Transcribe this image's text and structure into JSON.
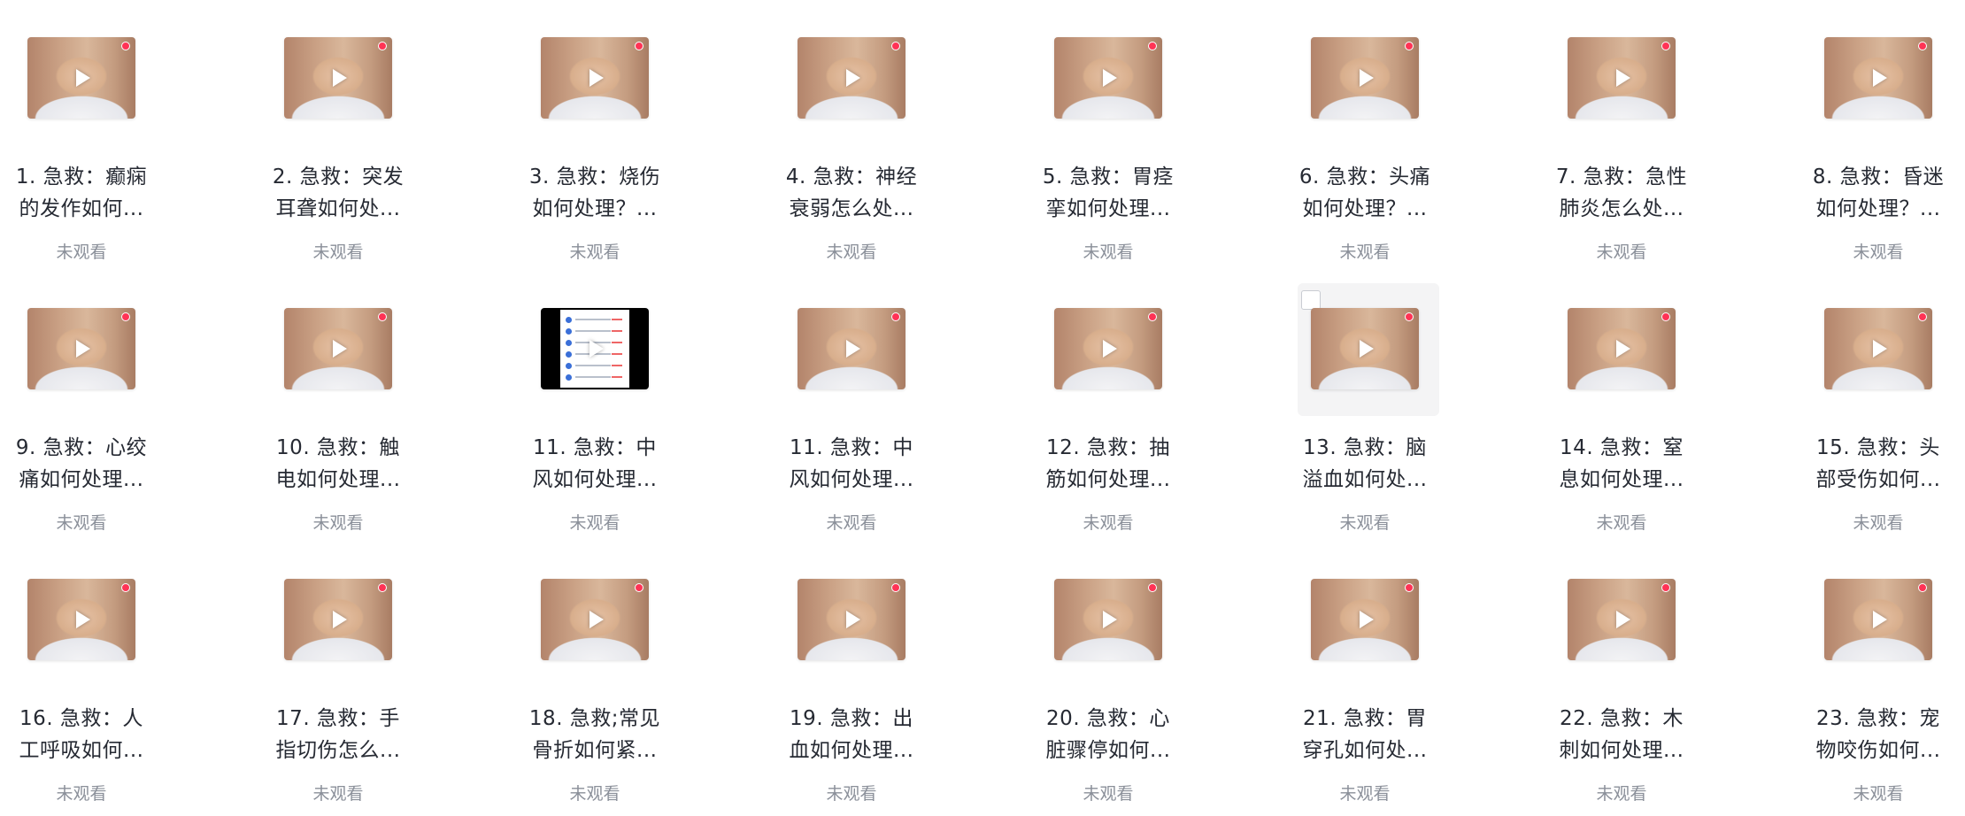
{
  "videos": [
    {
      "title1": "1. 急救：癫痫",
      "title2": "的发作如何...",
      "status": "未观看",
      "thumb": "photo"
    },
    {
      "title1": "2. 急救：突发",
      "title2": "耳聋如何处...",
      "status": "未观看",
      "thumb": "photo"
    },
    {
      "title1": "3. 急救：烧伤",
      "title2": "如何处理？...",
      "status": "未观看",
      "thumb": "photo"
    },
    {
      "title1": "4. 急救：神经",
      "title2": "衰弱怎么处...",
      "status": "未观看",
      "thumb": "photo"
    },
    {
      "title1": "5. 急救：胃痉",
      "title2": "挛如何处理...",
      "status": "未观看",
      "thumb": "photo"
    },
    {
      "title1": "6. 急救：头痛",
      "title2": "如何处理？...",
      "status": "未观看",
      "thumb": "photo"
    },
    {
      "title1": "7. 急救：急性",
      "title2": "肺炎怎么处...",
      "status": "未观看",
      "thumb": "photo"
    },
    {
      "title1": "8. 急救：昏迷",
      "title2": "如何处理？...",
      "status": "未观看",
      "thumb": "photo"
    },
    {
      "title1": "9. 急救：心绞",
      "title2": "痛如何处理...",
      "status": "未观看",
      "thumb": "photo"
    },
    {
      "title1": "10. 急救：触",
      "title2": "电如何处理...",
      "status": "未观看",
      "thumb": "photo"
    },
    {
      "title1": "11. 急救：中",
      "title2": "风如何处理...",
      "status": "未观看",
      "thumb": "screen"
    },
    {
      "title1": "11. 急救：中",
      "title2": "风如何处理...",
      "status": "未观看",
      "thumb": "photo"
    },
    {
      "title1": "12. 急救：抽",
      "title2": "筋如何处理...",
      "status": "未观看",
      "thumb": "photo"
    },
    {
      "title1": "13. 急救：脑",
      "title2": "溢血如何处...",
      "status": "未观看",
      "thumb": "photo",
      "hovered": true
    },
    {
      "title1": "14. 急救：窒",
      "title2": "息如何处理...",
      "status": "未观看",
      "thumb": "photo"
    },
    {
      "title1": "15. 急救：头",
      "title2": "部受伤如何...",
      "status": "未观看",
      "thumb": "photo"
    },
    {
      "title1": "16. 急救：人",
      "title2": "工呼吸如何...",
      "status": "未观看",
      "thumb": "photo"
    },
    {
      "title1": "17. 急救：手",
      "title2": "指切伤怎么...",
      "status": "未观看",
      "thumb": "photo"
    },
    {
      "title1": "18. 急救;常见",
      "title2": "骨折如何紧...",
      "status": "未观看",
      "thumb": "photo"
    },
    {
      "title1": "19. 急救：出",
      "title2": "血如何处理...",
      "status": "未观看",
      "thumb": "photo"
    },
    {
      "title1": "20. 急救：心",
      "title2": "脏骤停如何...",
      "status": "未观看",
      "thumb": "photo"
    },
    {
      "title1": "21. 急救：胃",
      "title2": "穿孔如何处...",
      "status": "未观看",
      "thumb": "photo"
    },
    {
      "title1": "22. 急救：木",
      "title2": "刺如何处理...",
      "status": "未观看",
      "thumb": "photo"
    },
    {
      "title1": "23. 急救：宠",
      "title2": "物咬伤如何...",
      "status": "未观看",
      "thumb": "photo"
    }
  ],
  "icons": {
    "play": "play-icon",
    "rec": "recording-dot-icon",
    "checkbox": "checkbox-icon"
  },
  "colors": {
    "title": "#262a33",
    "status": "#8a8f99",
    "rec": "#ff3355",
    "hover_bg": "#f4f4f5"
  }
}
